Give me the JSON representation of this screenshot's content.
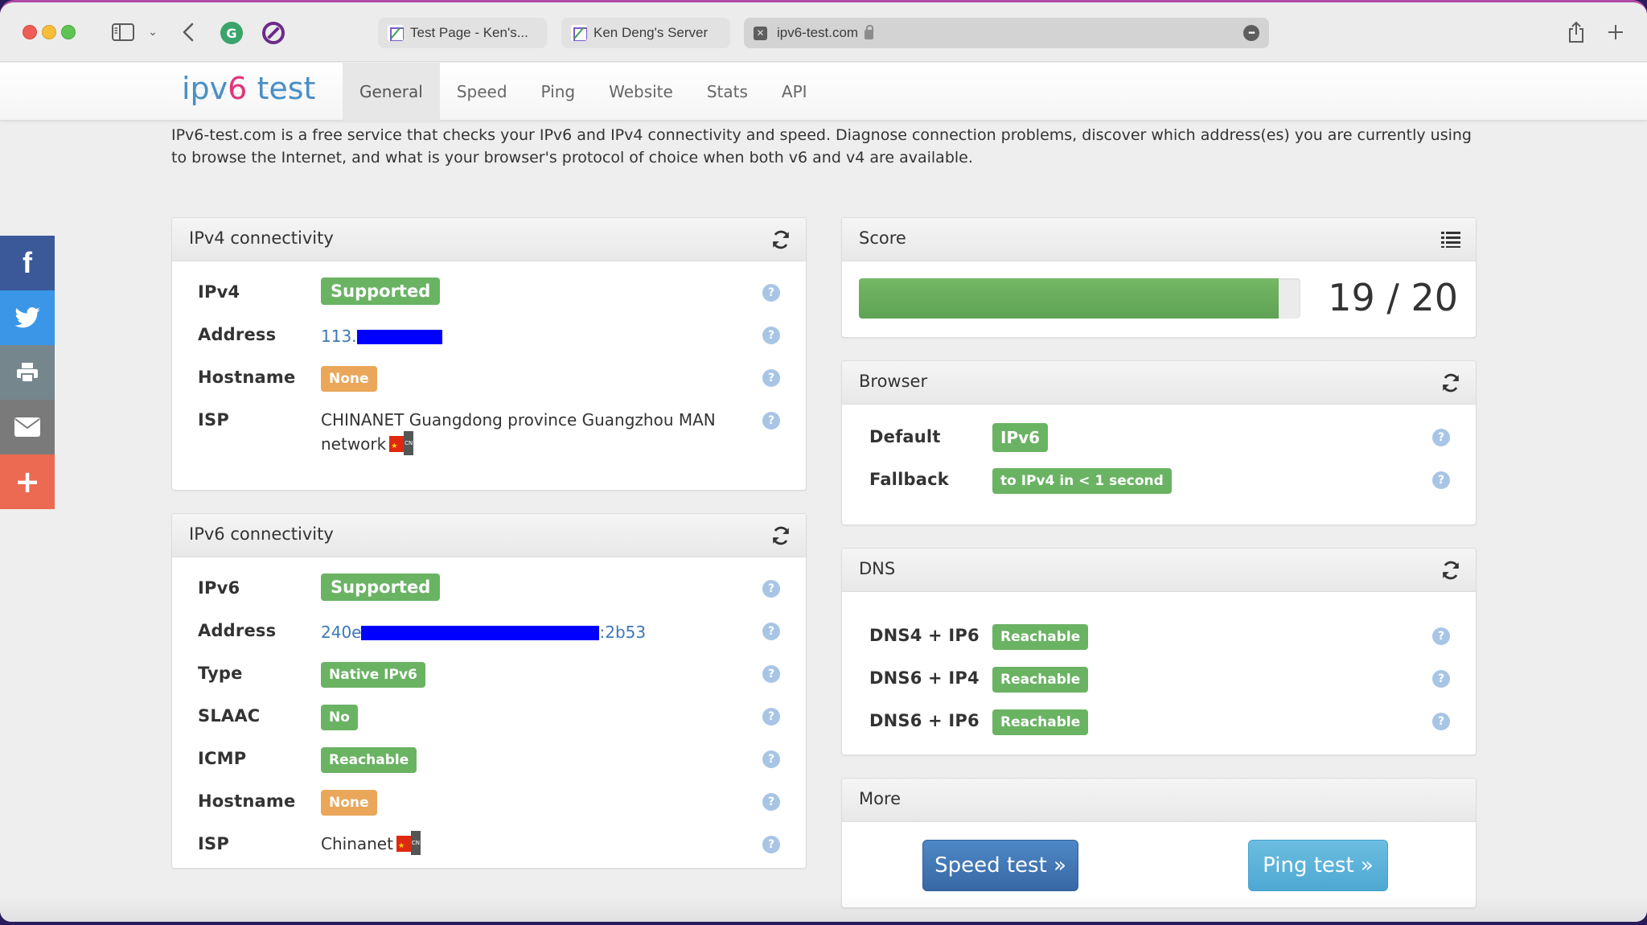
{
  "browser": {
    "tabs": [
      {
        "title": "Test Page - Ken's..."
      },
      {
        "title": "Ken Deng's Server"
      },
      {
        "title": "ipv6-test.com",
        "active": true
      }
    ],
    "icons": {
      "sidebar": "sidebar-icon",
      "back": "chevron-left-icon",
      "share": "share-icon",
      "new_tab": "plus-icon"
    }
  },
  "site": {
    "brand_prefix": "ipv",
    "brand_six": "6",
    "brand_suffix": " test",
    "nav": [
      "General",
      "Speed",
      "Ping",
      "Website",
      "Stats",
      "API"
    ],
    "active_nav": "General",
    "intro": "IPv6-test.com is a free service that checks your IPv6 and IPv4 connectivity and speed. Diagnose connection problems, discover which address(es) you are currently using to browse the Internet, and what is your browser's protocol of choice when both v6 and v4 are available."
  },
  "social": [
    "facebook",
    "twitter",
    "print",
    "email",
    "more"
  ],
  "ipv4": {
    "title": "IPv4 connectivity",
    "rows": {
      "ipv4": {
        "label": "IPv4",
        "value": "Supported"
      },
      "address": {
        "label": "Address",
        "value": "113."
      },
      "hostname": {
        "label": "Hostname",
        "value": "None"
      },
      "isp": {
        "label": "ISP",
        "value": "CHINANET Guangdong province Guangzhou MAN network",
        "country": "CN"
      }
    }
  },
  "ipv6": {
    "title": "IPv6 connectivity",
    "rows": {
      "ipv6": {
        "label": "IPv6",
        "value": "Supported"
      },
      "address": {
        "label": "Address",
        "prefix": "240e",
        "suffix": ":2b53"
      },
      "type": {
        "label": "Type",
        "value": "Native IPv6"
      },
      "slaac": {
        "label": "SLAAC",
        "value": "No"
      },
      "icmp": {
        "label": "ICMP",
        "value": "Reachable"
      },
      "hostname": {
        "label": "Hostname",
        "value": "None"
      },
      "isp": {
        "label": "ISP",
        "value": "Chinanet",
        "country": "CN"
      }
    }
  },
  "score": {
    "title": "Score",
    "value": 19,
    "max": 20,
    "text": "19 / 20"
  },
  "browser_panel": {
    "title": "Browser",
    "default": {
      "label": "Default",
      "value": "IPv6"
    },
    "fallback": {
      "label": "Fallback",
      "value": "to IPv4 in < 1 second"
    }
  },
  "dns": {
    "title": "DNS",
    "rows": [
      {
        "label": "DNS4 + IP6",
        "value": "Reachable"
      },
      {
        "label": "DNS6 + IP4",
        "value": "Reachable"
      },
      {
        "label": "DNS6 + IP6",
        "value": "Reachable"
      }
    ]
  },
  "more": {
    "title": "More",
    "speed_test": "Speed test »",
    "ping_test": "Ping test »"
  },
  "help_glyph": "?",
  "colors": {
    "success": "#6ab363",
    "warning": "#eaa75a",
    "link": "#3d78b6",
    "redaction": "#0000ff"
  }
}
